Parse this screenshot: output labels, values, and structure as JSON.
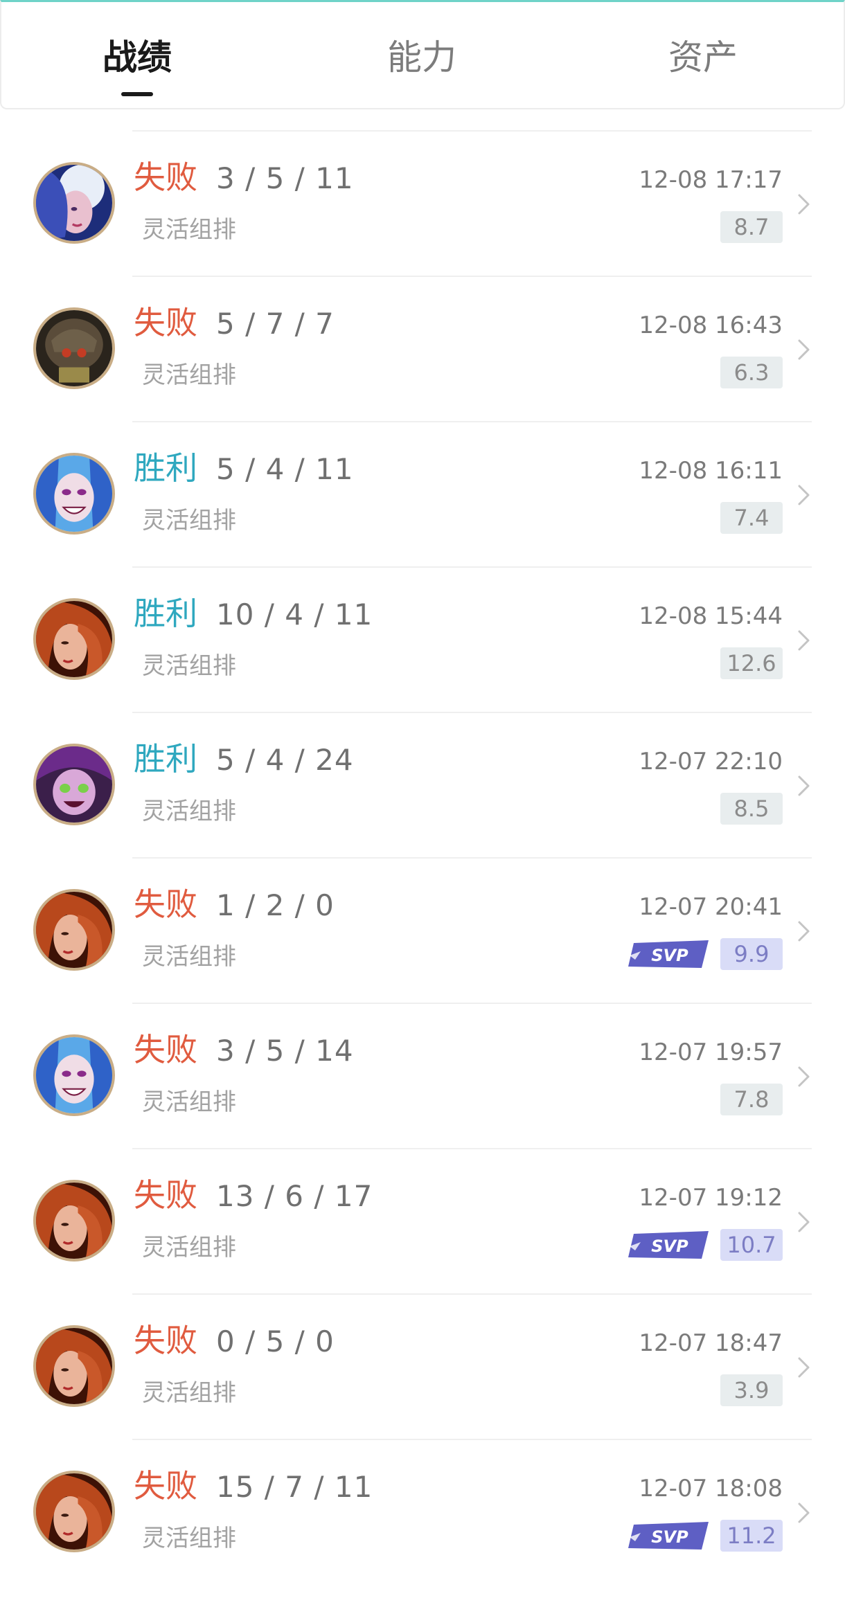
{
  "tabs": [
    {
      "label": "战绩",
      "active": true
    },
    {
      "label": "能力",
      "active": false
    },
    {
      "label": "资产",
      "active": false
    }
  ],
  "colors": {
    "lose": "#e05b3f",
    "win": "#2fa8bf",
    "svp_badge": "#5e5fc4",
    "score_bg": "#e8edee",
    "svp_score_bg": "#d9dcf7",
    "avatar_ring": "#c9ad86"
  },
  "matches": [
    {
      "result": "失败",
      "outcome": "lose",
      "kda": "3 / 5 / 11",
      "mode": "灵活组排",
      "time": "12-08 17:17",
      "score": "8.7",
      "svp": false,
      "champion_icon": "ashe-avatar-icon"
    },
    {
      "result": "失败",
      "outcome": "lose",
      "kda": "5 / 7 / 7",
      "mode": "灵活组排",
      "time": "12-08 16:43",
      "score": "6.3",
      "svp": false,
      "champion_icon": "dark-helmet-avatar-icon"
    },
    {
      "result": "胜利",
      "outcome": "win",
      "kda": "5 / 4 / 11",
      "mode": "灵活组排",
      "time": "12-08 16:11",
      "score": "7.4",
      "svp": false,
      "champion_icon": "jinx-avatar-icon"
    },
    {
      "result": "胜利",
      "outcome": "win",
      "kda": "10 / 4 / 11",
      "mode": "灵活组排",
      "time": "12-08 15:44",
      "score": "12.6",
      "svp": false,
      "champion_icon": "miss-fortune-avatar-icon"
    },
    {
      "result": "胜利",
      "outcome": "win",
      "kda": "5 / 4 / 24",
      "mode": "灵活组排",
      "time": "12-07 22:10",
      "score": "8.5",
      "svp": false,
      "champion_icon": "purple-hair-avatar-icon"
    },
    {
      "result": "失败",
      "outcome": "lose",
      "kda": "1 / 2 / 0",
      "mode": "灵活组排",
      "time": "12-07 20:41",
      "score": "9.9",
      "svp": true,
      "badge": "SVP",
      "champion_icon": "miss-fortune-avatar-icon"
    },
    {
      "result": "失败",
      "outcome": "lose",
      "kda": "3 / 5 / 14",
      "mode": "灵活组排",
      "time": "12-07 19:57",
      "score": "7.8",
      "svp": false,
      "champion_icon": "jinx-avatar-icon"
    },
    {
      "result": "失败",
      "outcome": "lose",
      "kda": "13 / 6 / 17",
      "mode": "灵活组排",
      "time": "12-07 19:12",
      "score": "10.7",
      "svp": true,
      "badge": "SVP",
      "champion_icon": "miss-fortune-avatar-icon"
    },
    {
      "result": "失败",
      "outcome": "lose",
      "kda": "0 / 5 / 0",
      "mode": "灵活组排",
      "time": "12-07 18:47",
      "score": "3.9",
      "svp": false,
      "champion_icon": "miss-fortune-avatar-icon"
    },
    {
      "result": "失败",
      "outcome": "lose",
      "kda": "15 / 7 / 11",
      "mode": "灵活组排",
      "time": "12-07 18:08",
      "score": "11.2",
      "svp": true,
      "badge": "SVP",
      "champion_icon": "miss-fortune-avatar-icon"
    }
  ]
}
